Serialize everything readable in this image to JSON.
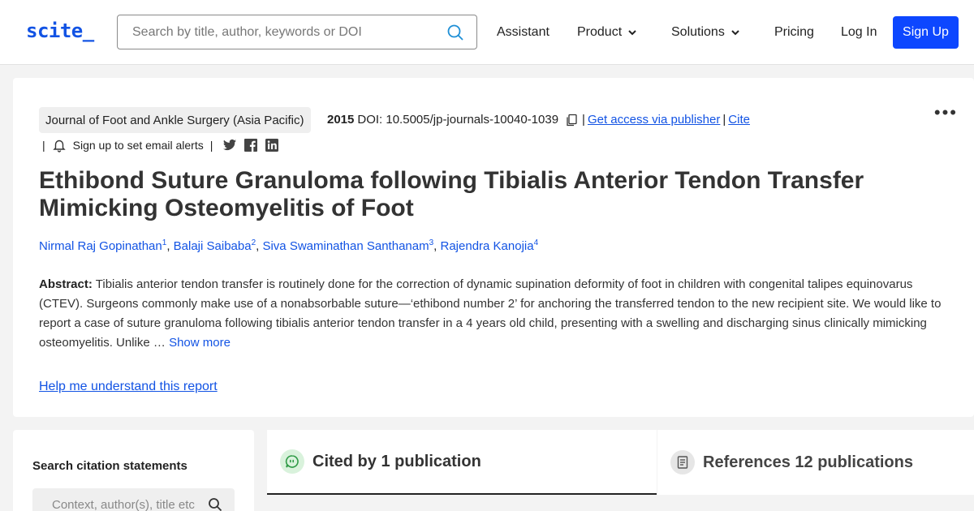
{
  "header": {
    "logo": "scite_",
    "search_placeholder": "Search by title, author, keywords or DOI",
    "nav": {
      "assistant": "Assistant",
      "product": "Product",
      "solutions": "Solutions",
      "pricing": "Pricing",
      "login": "Log In",
      "signup": "Sign Up"
    }
  },
  "article": {
    "journal": "Journal of Foot and Ankle Surgery (Asia Pacific)",
    "year": "2015",
    "doi": "DOI: 10.5005/jp-journals-10040-1039",
    "access_link": "Get access via publisher",
    "cite_link": "Cite",
    "alerts_label": "Sign up to set email alerts",
    "title": "Ethibond Suture Granuloma following Tibialis Anterior Tendon Transfer Mimicking Osteomyelitis of Foot",
    "authors": [
      {
        "name": "Nirmal Raj Gopinathan",
        "sup": "1"
      },
      {
        "name": "Balaji Saibaba",
        "sup": "2"
      },
      {
        "name": "Siva Swaminathan Santhanam",
        "sup": "3"
      },
      {
        "name": "Rajendra Kanojia",
        "sup": "4"
      }
    ],
    "abstract_label": "Abstract:",
    "abstract_text": "Tibialis anterior tendon transfer is routinely done for the correction of dynamic supination deformity of foot in children with congenital talipes equinovarus (CTEV). Surgeons commonly make use of a nonabsorbable suture—‘ethibond number 2’ for anchoring the transferred tendon to the new recipient site. We would like to report a case of suture granuloma following tibialis anterior tendon transfer in a 4 years old child, presenting with a swelling and discharging sinus clinically mimicking osteomyelitis. Unlike …",
    "show_more": "Show more",
    "help_link": "Help me understand this report"
  },
  "sidebar": {
    "title": "Search citation statements",
    "placeholder": "Context, author(s), title etc."
  },
  "tabs": {
    "cited": "Cited by 1 publication",
    "references": "References 12 publications"
  },
  "colors": {
    "brand": "#1253e4",
    "signup_bg": "#0d47ff",
    "cited_icon_bg": "#d9f2dc"
  },
  "icons": {
    "search": "search-icon",
    "chevron": "chevron-down-icon",
    "copy": "copy-icon",
    "bell": "bell-icon",
    "twitter": "twitter-icon",
    "facebook": "facebook-icon",
    "linkedin": "linkedin-icon",
    "more": "more-options-icon",
    "quote": "quote-bubble-icon",
    "document": "document-icon"
  }
}
